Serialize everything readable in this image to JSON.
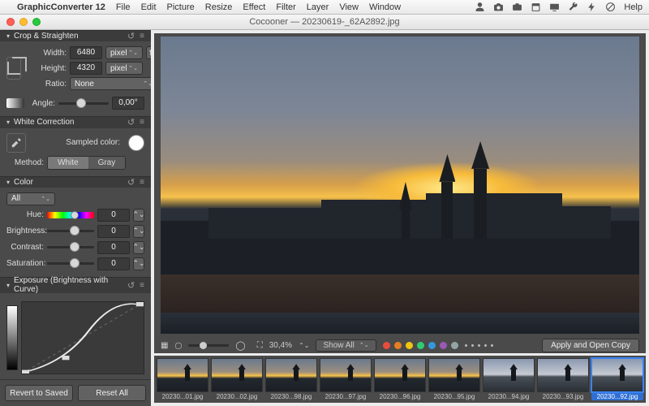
{
  "menubar": {
    "app": "GraphicConverter 12",
    "items": [
      "File",
      "Edit",
      "Picture",
      "Resize",
      "Effect",
      "Filter",
      "Layer",
      "View",
      "Window"
    ],
    "help": "Help"
  },
  "window": {
    "title_left": "Cocooner",
    "title_right": "20230619-_62A2892.jpg"
  },
  "panels": {
    "crop": {
      "title": "Crop & Straighten",
      "width_label": "Width:",
      "height_label": "Height:",
      "ratio_label": "Ratio:",
      "angle_label": "Angle:",
      "width_value": "6480",
      "height_value": "4320",
      "unit": "pixel",
      "ratio_value": "None",
      "angle_value": "0,00°"
    },
    "white": {
      "title": "White Correction",
      "sampled_label": "Sampled color:",
      "method_label": "Method:",
      "method_white": "White",
      "method_gray": "Gray"
    },
    "color": {
      "title": "Color",
      "channel": "All",
      "hue_label": "Hue:",
      "brightness_label": "Brightness:",
      "contrast_label": "Contrast:",
      "saturation_label": "Saturation:",
      "zero": "0"
    },
    "exposure": {
      "title": "Exposure (Brightness with Curve)"
    }
  },
  "footer": {
    "revert": "Revert to Saved",
    "reset": "Reset All"
  },
  "toolbar": {
    "zoom": "30,4%",
    "filter": "Show All",
    "apply": "Apply and Open Copy"
  },
  "filmstrip": [
    {
      "label": "20230...01.jpg",
      "sel": false,
      "alt": false
    },
    {
      "label": "20230...02.jpg",
      "sel": false,
      "alt": false
    },
    {
      "label": "20230...98.jpg",
      "sel": false,
      "alt": false
    },
    {
      "label": "20230...97.jpg",
      "sel": false,
      "alt": false
    },
    {
      "label": "20230...96.jpg",
      "sel": false,
      "alt": false
    },
    {
      "label": "20230...95.jpg",
      "sel": false,
      "alt": false
    },
    {
      "label": "20230...94.jpg",
      "sel": false,
      "alt": true
    },
    {
      "label": "20230...93.jpg",
      "sel": false,
      "alt": true
    },
    {
      "label": "20230...92.jpg",
      "sel": true,
      "alt": true
    }
  ],
  "color_tags": [
    "#e74c3c",
    "#e67e22",
    "#f1c40f",
    "#2ecc71",
    "#3498db",
    "#9b59b6",
    "#95a5a6"
  ]
}
